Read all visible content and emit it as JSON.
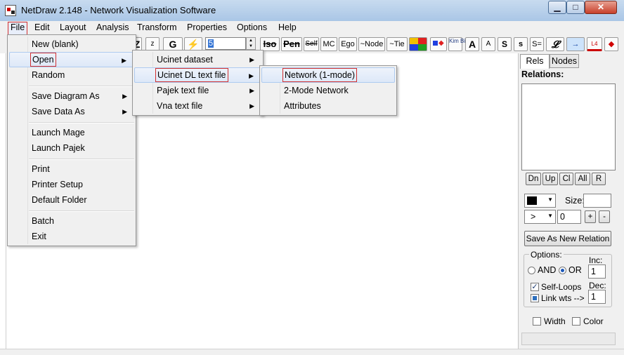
{
  "window": {
    "title": "NetDraw 2.148 - Network Visualization Software",
    "minimize": "▁",
    "maximize": "□",
    "close": "✕"
  },
  "menubar": [
    "File",
    "Edit",
    "Layout",
    "Analysis",
    "Transform",
    "Properties",
    "Options",
    "Help"
  ],
  "toolbar": {
    "z_upper": "Z",
    "z_lower": "z",
    "g": "G",
    "lightning_icon": "⚡",
    "size_value": "5",
    "iso": "Iso",
    "pen": "Pen",
    "self": "Self",
    "mc": "MC",
    "ego": "Ego",
    "node": "~Node",
    "tie": "~Tie",
    "kim_bill": "Kim Bill",
    "A_big": "A",
    "A_small": "A",
    "S_big": "S",
    "s_small": "s",
    "s_eq": "S=",
    "script_f": "𝓛",
    "arrow": "→",
    "l4": "L4",
    "diamond": "◆"
  },
  "file_menu": {
    "items": [
      "New (blank)",
      "Open",
      "Random",
      "Save Diagram As",
      "Save Data As",
      "Launch Mage",
      "Launch Pajek",
      "Print",
      "Printer Setup",
      "Default Folder",
      "Batch",
      "Exit"
    ]
  },
  "open_menu": {
    "items": [
      "Ucinet dataset",
      "Ucinet DL text file",
      "Pajek text file",
      "Vna text file"
    ]
  },
  "dl_menu": {
    "items": [
      "Network (1-mode)",
      "2-Mode Network",
      "Attributes"
    ]
  },
  "panel": {
    "tabs": [
      "Rels",
      "Nodes"
    ],
    "relations_label": "Relations:",
    "buttons": [
      "Dn",
      "Up",
      "Cl",
      "All",
      "R"
    ],
    "size_label": "Size:",
    "line_symbol": ">",
    "value_field": "0",
    "plus": "+",
    "minus": "-",
    "save_relation": "Save As New Relation",
    "options_label": "Options:",
    "and_label": "AND",
    "or_label": "OR",
    "inc_label": "Inc:",
    "inc_value": "1",
    "dec_label": "Dec:",
    "dec_value": "1",
    "self_loops": "Self-Loops",
    "link_wts": "Link wts -->",
    "width_label": "Width",
    "color_label": "Color",
    "checkmark": "✓",
    "dropdown_arrow": "▼"
  }
}
